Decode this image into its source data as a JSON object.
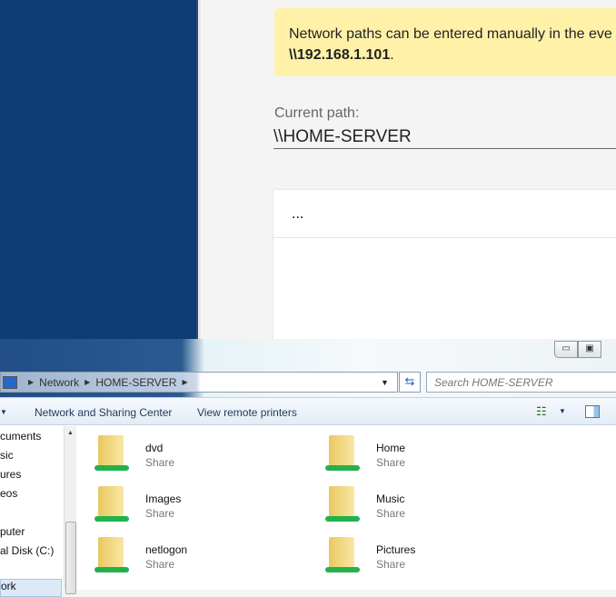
{
  "web": {
    "notice_text": "Network paths can be entered manually in the eve",
    "notice_example": "\\\\192.168.1.101",
    "notice_end": ".",
    "path_label": "Current path:",
    "path_value": "\\\\HOME-SERVER",
    "list_first_row": "..."
  },
  "explorer": {
    "breadcrumb": [
      "Network",
      "HOME-SERVER"
    ],
    "search_placeholder": "Search HOME-SERVER",
    "toolbar": {
      "network_sharing": "Network and Sharing Center",
      "remote_printers": "View remote printers"
    },
    "nav_items": [
      "cuments",
      "sic",
      "ures",
      "eos",
      "puter",
      "al Disk (C:)",
      "ork"
    ],
    "shares": [
      {
        "name": "dvd",
        "type": "Share"
      },
      {
        "name": "Home",
        "type": "Share"
      },
      {
        "name": "Images",
        "type": "Share"
      },
      {
        "name": "Music",
        "type": "Share"
      },
      {
        "name": "netlogon",
        "type": "Share"
      },
      {
        "name": "Pictures",
        "type": "Share"
      }
    ]
  }
}
